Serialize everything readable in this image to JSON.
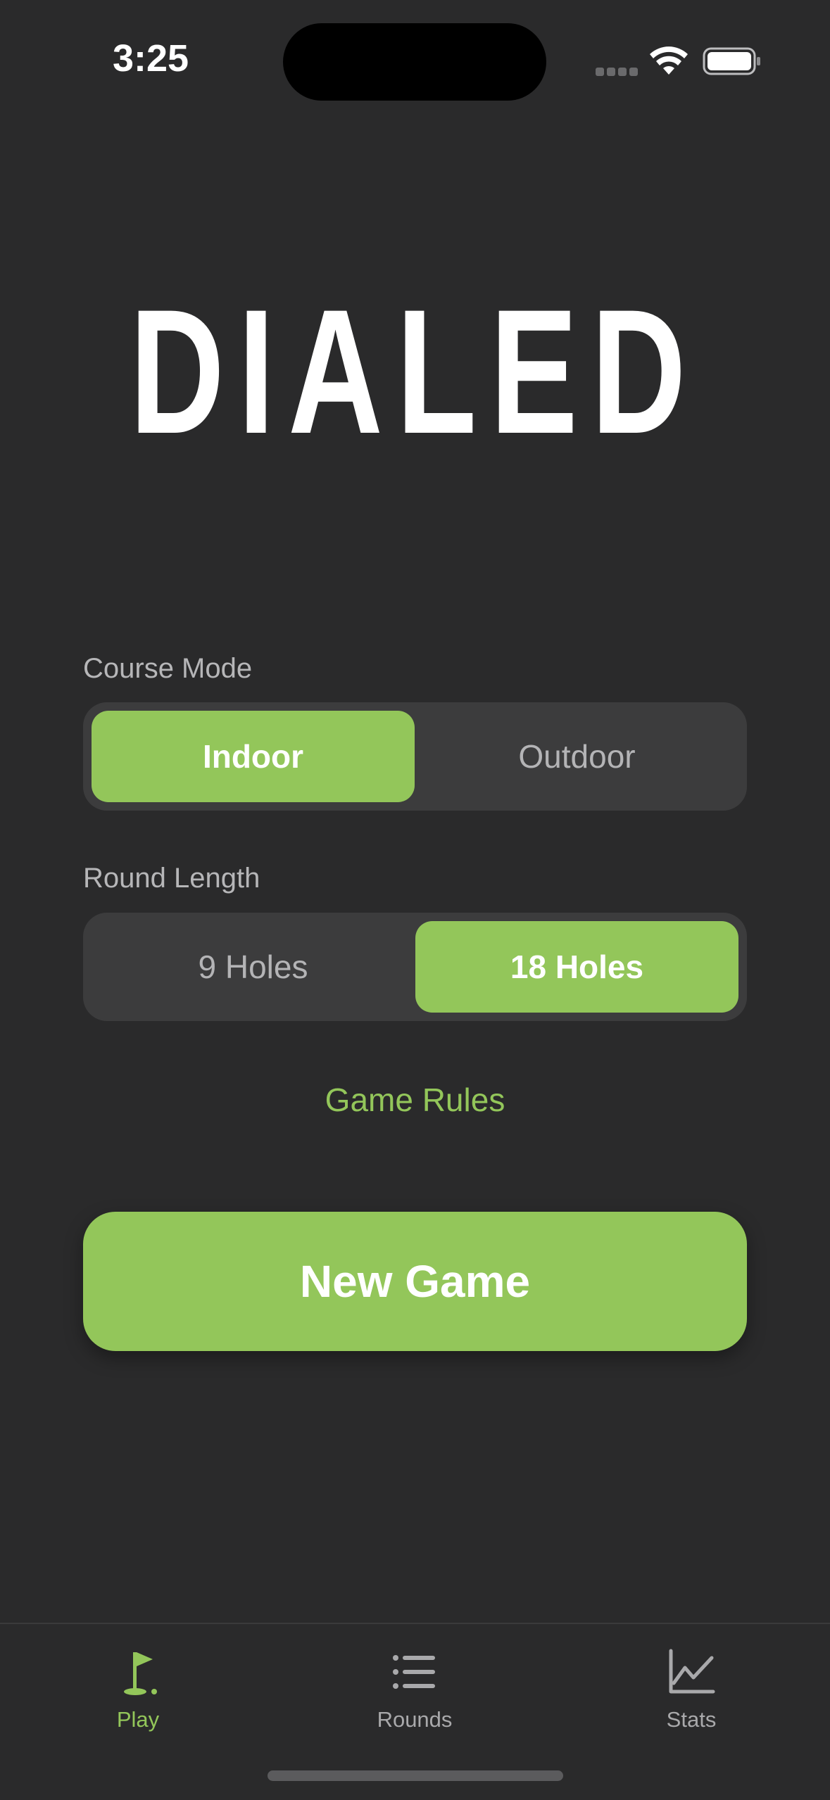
{
  "status_bar": {
    "time": "3:25"
  },
  "app": {
    "logo_text": "DIALED"
  },
  "course_mode": {
    "label": "Course Mode",
    "options": [
      "Indoor",
      "Outdoor"
    ],
    "selected": "Indoor"
  },
  "round_length": {
    "label": "Round Length",
    "options": [
      "9 Holes",
      "18 Holes"
    ],
    "selected": "18 Holes"
  },
  "links": {
    "game_rules": "Game Rules"
  },
  "actions": {
    "new_game": "New Game"
  },
  "tab_bar": {
    "items": [
      {
        "label": "Play",
        "icon": "golf-flag-icon",
        "active": true
      },
      {
        "label": "Rounds",
        "icon": "list-icon",
        "active": false
      },
      {
        "label": "Stats",
        "icon": "line-chart-icon",
        "active": false
      }
    ]
  },
  "colors": {
    "accent": "#93c65a",
    "background": "#2a2a2b",
    "segment_background": "#3c3c3d",
    "muted_text": "#b4b4b6"
  },
  "icons": {
    "wifi": "wifi-icon",
    "battery": "battery-icon",
    "signal": "cellular-signal-icon"
  }
}
